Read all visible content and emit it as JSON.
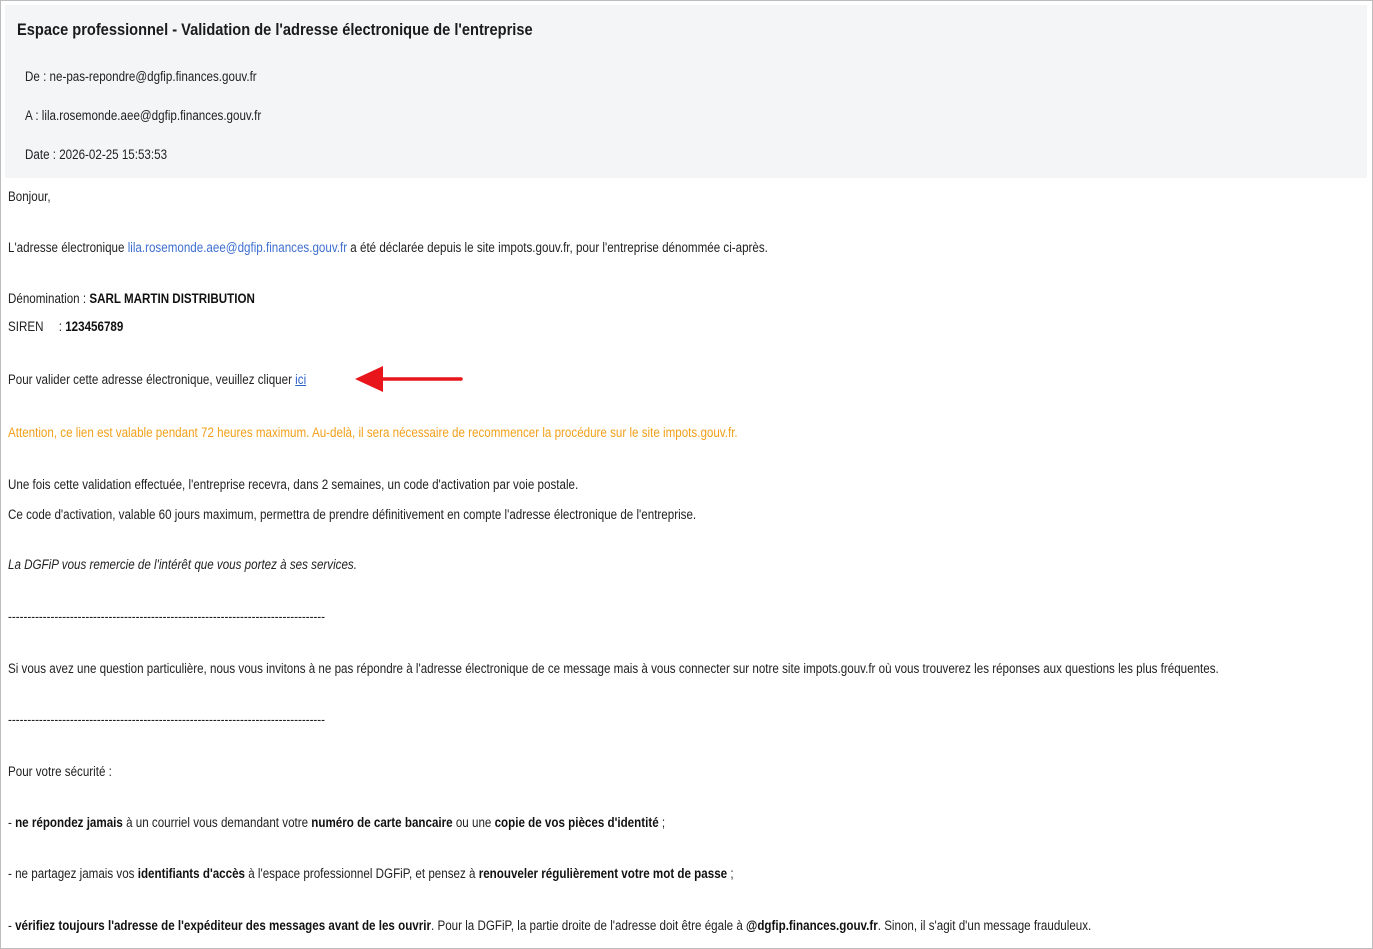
{
  "email": {
    "subject": "Espace professionnel - Validation de l'adresse électronique de l'entreprise",
    "from_label": "De :",
    "from": "ne-pas-repondre@dgfip.finances.gouv.fr",
    "to_label": "A :",
    "to": "lila.rosemonde.aee@dgfip.finances.gouv.fr",
    "date_label": "Date :",
    "date": "2026-02-25 15:53:53"
  },
  "body": {
    "greeting": "Bonjour,",
    "intro_prefix": "L'adresse électronique ",
    "intro_link": "lila.rosemonde.aee@dgfip.finances.gouv.fr",
    "intro_suffix": " a été déclarée depuis le site impots.gouv.fr, pour l'entreprise dénommée ci-après.",
    "denomination_label": "Dénomination : ",
    "denomination_value": "SARL MARTIN DISTRIBUTION",
    "siren_label": "SIREN",
    "siren_sep": ": ",
    "siren_value": "123456789",
    "validate_prefix": "Pour valider cette adresse électronique, veuillez cliquer ",
    "validate_link": "ici",
    "warning": "Attention, ce lien est valable pendant 72 heures maximum. Au-delà, il sera nécessaire de recommencer la procédure sur le site impots.gouv.fr.",
    "info_1": "Une fois cette validation effectuée, l'entreprise recevra, dans 2 semaines, un code d'activation par voie postale.",
    "info_2": "Ce code d'activation, valable 60 jours maximum, permettra de prendre définitivement en compte l'adresse électronique de l'entreprise.",
    "thanks": "La DGFiP vous remercie de l'intérêt que vous portez à ses services.",
    "separator_1": "----------------------------------------------------------------------------------",
    "question": "Si vous avez une question particulière, nous vous invitons à ne pas répondre à l'adresse électronique de ce message mais à vous connecter sur notre site impots.gouv.fr où vous trouverez les réponses aux questions les plus fréquentes.",
    "separator_2": "----------------------------------------------------------------------------------",
    "security_title": "Pour votre sécurité :",
    "sec1_a": "- ",
    "sec1_b": "ne répondez jamais",
    "sec1_c": " à un courriel vous demandant votre ",
    "sec1_d": "numéro de carte bancaire",
    "sec1_e": " ou une ",
    "sec1_f": "copie de vos pièces d'identité",
    "sec1_g": " ;",
    "sec2_a": "- ne partagez jamais vos ",
    "sec2_b": "identifiants d'accès",
    "sec2_c": " à l'espace professionnel DGFiP, et pensez à ",
    "sec2_d": "renouveler régulièrement votre mot de passe",
    "sec2_e": " ;",
    "sec3_a": "- ",
    "sec3_b": "vérifiez toujours l'adresse de l'expéditeur des messages avant de les ouvrir",
    "sec3_c": ". Pour la DGFiP, la partie droite de l'adresse doit être égale à ",
    "sec3_d": "@dgfip.finances.gouv.fr",
    "sec3_e": ". Sinon, il s'agit d'un message frauduleux."
  },
  "annotation": {
    "arrow_icon": "red-left-arrow-icon",
    "arrow_color": "#e8161b"
  },
  "colors": {
    "header_bg": "#f4f5f7",
    "link": "#3f6fd0",
    "warning": "#f2a01c"
  }
}
